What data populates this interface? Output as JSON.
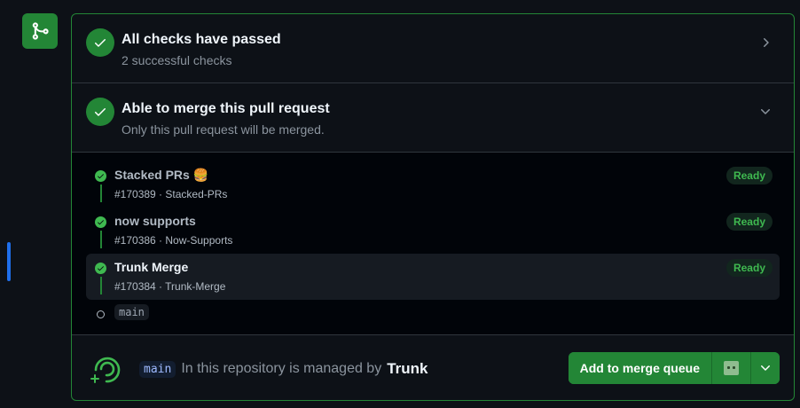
{
  "checks": {
    "title": "All checks have passed",
    "subtitle": "2 successful checks"
  },
  "merge": {
    "title": "Able to merge this pull request",
    "subtitle": "Only this pull request will be merged."
  },
  "stack": {
    "prs": [
      {
        "title": "Stacked PRs 🍔",
        "meta": "#170389 · Stacked-PRs",
        "status": "Ready",
        "active": false
      },
      {
        "title": "now supports",
        "meta": "#170386 · Now-Supports",
        "status": "Ready",
        "active": false
      },
      {
        "title": "Trunk Merge",
        "meta": "#170384 · Trunk-Merge",
        "status": "Ready",
        "active": true
      }
    ],
    "base_branch": "main"
  },
  "footer": {
    "branch": "main",
    "text": "In this repository is managed by",
    "brand": "Trunk",
    "primary_button": "Add to merge queue"
  },
  "colors": {
    "success": "#238636",
    "ready_text": "#3fb950",
    "active_accent": "#1f6feb",
    "background": "#0d1117"
  },
  "icons": [
    "git-merge-icon",
    "check-icon",
    "chevron-right-icon",
    "chevron-down-icon",
    "trunk-logo-icon",
    "emoji-icon"
  ]
}
